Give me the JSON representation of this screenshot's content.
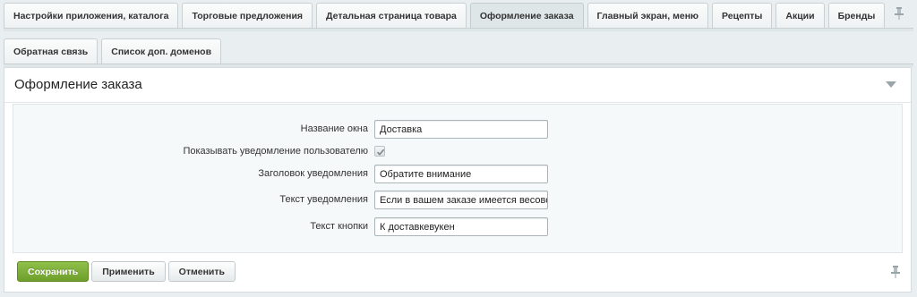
{
  "tabs_row1": [
    {
      "label": "Настройки приложения, каталога",
      "active": false
    },
    {
      "label": "Торговые предложения",
      "active": false
    },
    {
      "label": "Детальная страница товара",
      "active": false
    },
    {
      "label": "Оформление заказа",
      "active": true
    },
    {
      "label": "Главный экран, меню",
      "active": false
    },
    {
      "label": "Рецепты",
      "active": false
    },
    {
      "label": "Акции",
      "active": false
    },
    {
      "label": "Бренды",
      "active": false
    }
  ],
  "tabs_row2": [
    {
      "label": "Обратная связь",
      "active": false
    },
    {
      "label": "Список доп. доменов",
      "active": false
    }
  ],
  "section": {
    "title": "Оформление заказа"
  },
  "form": {
    "window_name": {
      "label": "Название окна",
      "value": "Доставка"
    },
    "show_notification": {
      "label": "Показывать уведомление пользователю",
      "checked": true
    },
    "notification_title": {
      "label": "Заголовок уведомления",
      "value": "Обратите внимание"
    },
    "notification_text": {
      "label": "Текст уведомления",
      "value": "Если в вашем заказе имеется весовой"
    },
    "button_text": {
      "label": "Текст кнопки",
      "value": "К доставкевукен"
    }
  },
  "buttons": {
    "save": "Сохранить",
    "apply": "Применить",
    "cancel": "Отменить"
  },
  "colors": {
    "primary_button": "#7bad35",
    "background": "#e9eef0",
    "active_tab": "#dfe6e8"
  }
}
